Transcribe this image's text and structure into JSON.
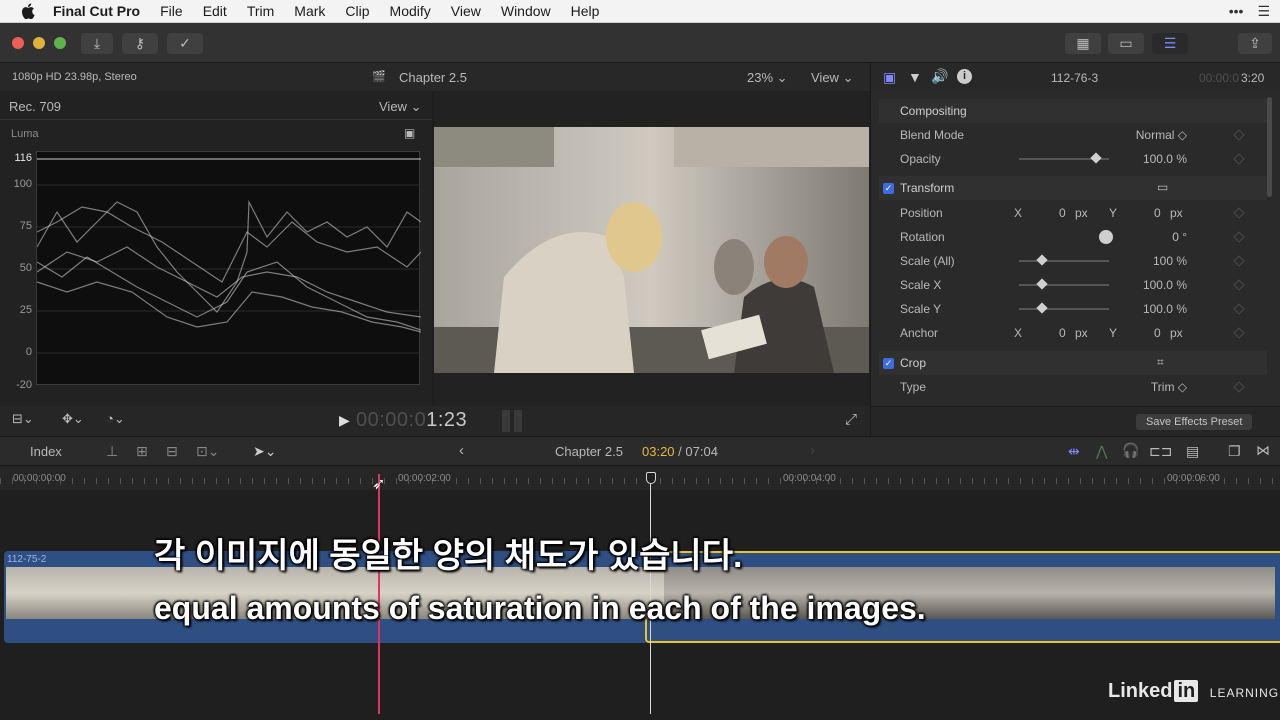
{
  "menubar": {
    "app": "Final Cut Pro",
    "items": [
      "File",
      "Edit",
      "Trim",
      "Mark",
      "Clip",
      "Modify",
      "View",
      "Window",
      "Help"
    ]
  },
  "viewer": {
    "format": "1080p HD 23.98p, Stereo",
    "title": "Chapter 2.5",
    "zoom": "23%",
    "view_label": "View",
    "timecode_dim": "00:00:0",
    "timecode": "1:23"
  },
  "scope": {
    "colorspace": "Rec. 709",
    "view_label": "View",
    "mode": "Luma",
    "scale": [
      "116",
      "100",
      "75",
      "50",
      "25",
      "0",
      "-20"
    ]
  },
  "inspector": {
    "clip_name": "112-76-3",
    "duration_dim": "00:00:0",
    "duration": "3:20",
    "rows": [
      {
        "label": "Compositing",
        "type": "sect"
      },
      {
        "label": "Blend Mode",
        "value": "Normal ◇"
      },
      {
        "label": "Opacity",
        "value": "100.0 %",
        "slider": 0.85
      },
      {
        "label": "Transform",
        "type": "sectcb"
      },
      {
        "label": "Position",
        "x": "0",
        "y": "0",
        "unit": "px"
      },
      {
        "label": "Rotation",
        "value": "0 °"
      },
      {
        "label": "Scale (All)",
        "value": "100 %",
        "slider": 0.25
      },
      {
        "label": "Scale X",
        "value": "100.0 %",
        "slider": 0.25
      },
      {
        "label": "Scale Y",
        "value": "100.0 %",
        "slider": 0.25
      },
      {
        "label": "Anchor",
        "x": "0",
        "y": "0",
        "unit": "px"
      },
      {
        "label": "Crop",
        "type": "sectcb"
      },
      {
        "label": "Type",
        "value": "Trim ◇"
      }
    ],
    "axis_x": "X",
    "axis_y": "Y",
    "save_preset": "Save Effects Preset"
  },
  "timeline": {
    "index_label": "Index",
    "project": "Chapter 2.5",
    "position": "03:20",
    "total": "/ 07:04",
    "ruler": [
      "00:00:00:00",
      "00:00:02:00",
      "00:00:04:00",
      "00:00:06:00"
    ],
    "clip1_name": "112-75-2"
  },
  "subtitles": {
    "korean": "각 이미지에 동일한 양의 채도가 있습니다.",
    "english": "equal amounts of saturation in each of the images."
  },
  "brand": {
    "name": "Linked",
    "badge": "in",
    "tag": "LEARNING"
  },
  "colors": {
    "accent": "#7f88ff",
    "playhead": "#e0315f",
    "selection": "#e6c52a",
    "clip": "#2f4f82"
  }
}
